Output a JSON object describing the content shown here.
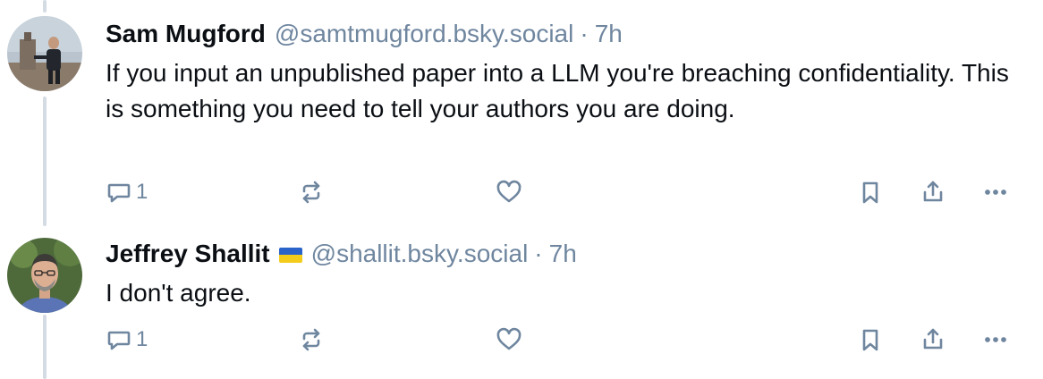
{
  "posts": [
    {
      "author_name": "Sam Mugford",
      "handle": "@samtmugford.bsky.social",
      "separator": "·",
      "time": "7h",
      "text": "If you input an unpublished paper into a LLM you're breaching confidentiality. This is something you need to tell your authors you are doing.",
      "reply_count": "1",
      "has_flag": false
    },
    {
      "author_name": "Jeffrey Shallit",
      "handle": "@shallit.bsky.social",
      "separator": "·",
      "time": "7h",
      "text": "I don't agree.",
      "reply_count": "1",
      "has_flag": true
    }
  ],
  "colors": {
    "text_primary": "#0b0f14",
    "text_secondary": "#6f869f",
    "thread_line": "#d4dbe2",
    "flag_blue": "#2a63c9",
    "flag_yellow": "#f4cc1c"
  },
  "icons": [
    "reply-icon",
    "repost-icon",
    "like-icon",
    "bookmark-icon",
    "share-icon",
    "more-icon"
  ]
}
